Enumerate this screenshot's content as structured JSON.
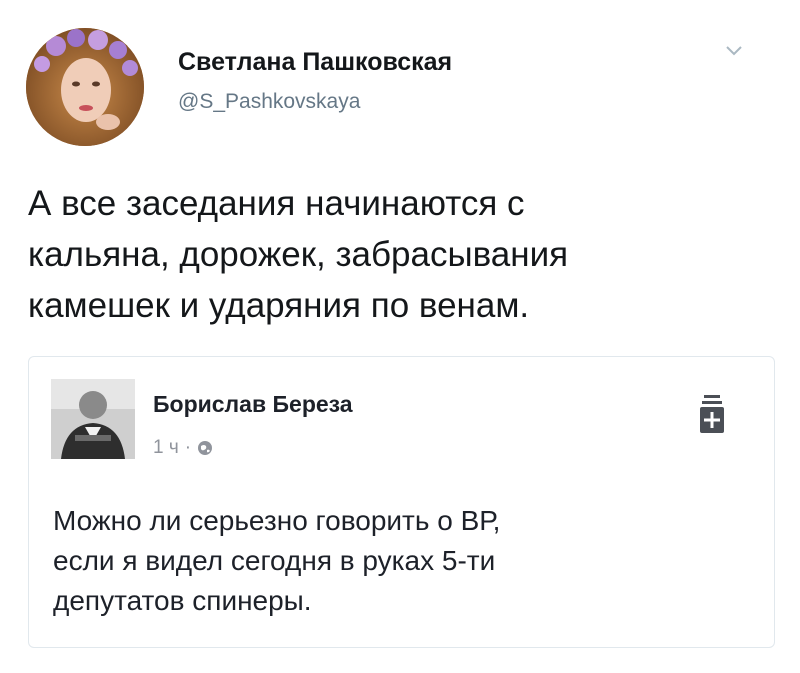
{
  "author": {
    "display_name": "Светлана Пашковская",
    "handle": "@S_Pashkovskaya"
  },
  "icons": {
    "avatar": "profile-photo",
    "caret": "chevron-down-icon",
    "save": "save-bookmark-icon",
    "globe": "globe-icon"
  },
  "tweet": {
    "lines": [
      "А все заседания начинаются с",
      "кальяна, дорожек, забрасывания",
      "камешек и ударяния по венам."
    ]
  },
  "quoted_post": {
    "author_name": "Борислав Береза",
    "time": "1 ч",
    "separator": "·",
    "lines": [
      "Можно ли серьезно говорить о ВР,",
      "если я видел сегодня в руках 5-ти",
      "депутатов спинеры."
    ]
  },
  "colors": {
    "name": "#14171a",
    "handle": "#657786",
    "card_border": "#e1e8ed",
    "fb_meta": "#90949c"
  }
}
